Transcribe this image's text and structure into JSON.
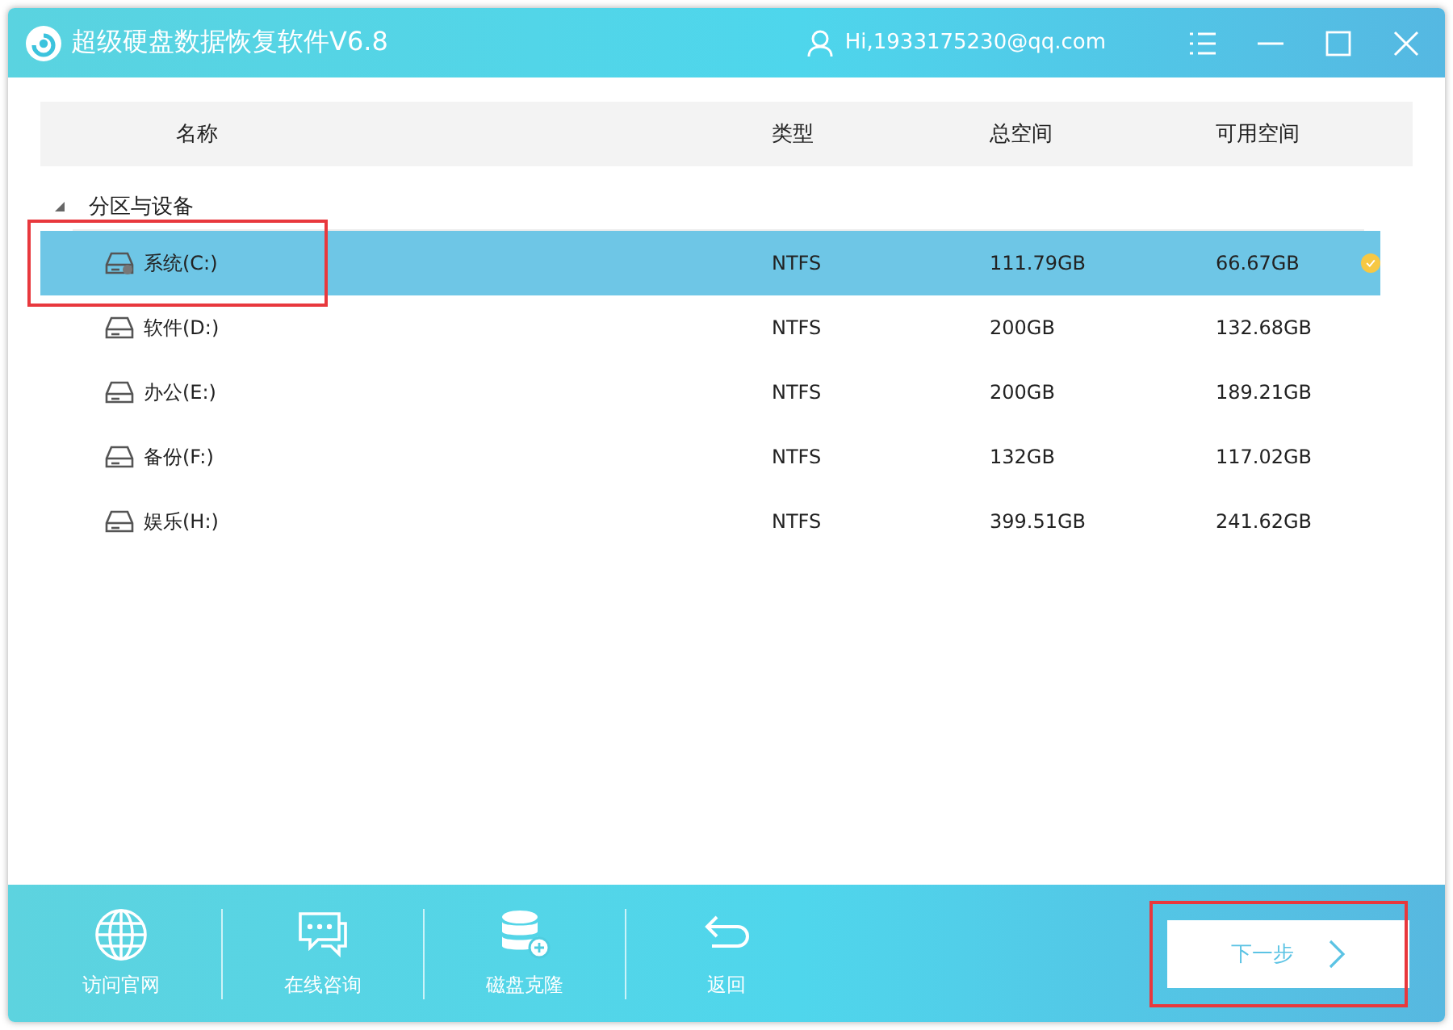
{
  "window": {
    "title": "超级硬盘数据恢复软件V6.8",
    "user": "Hi,1933175230@qq.com"
  },
  "table": {
    "columns": [
      "名称",
      "类型",
      "总空间",
      "可用空间"
    ],
    "group": {
      "label": "分区与设备",
      "expanded": true,
      "partitions": [
        {
          "name": "系统(C:)",
          "kind": "system",
          "type": "NTFS",
          "total": "111.79GB",
          "free": "66.67GB",
          "selected": true,
          "highlighted": true
        },
        {
          "name": "软件(D:)",
          "kind": "drive",
          "type": "NTFS",
          "total": "200GB",
          "free": "132.68GB",
          "selected": false,
          "highlighted": false
        },
        {
          "name": "办公(E:)",
          "kind": "drive",
          "type": "NTFS",
          "total": "200GB",
          "free": "189.21GB",
          "selected": false,
          "highlighted": false
        },
        {
          "name": "备份(F:)",
          "kind": "drive",
          "type": "NTFS",
          "total": "132GB",
          "free": "117.02GB",
          "selected": false,
          "highlighted": false
        },
        {
          "name": "娱乐(H:)",
          "kind": "drive",
          "type": "NTFS",
          "total": "399.51GB",
          "free": "241.62GB",
          "selected": false,
          "highlighted": false
        }
      ]
    }
  },
  "toolbar": [
    {
      "label": "访问官网",
      "kind": "globe"
    },
    {
      "label": "在线咨询",
      "kind": "chat"
    },
    {
      "label": "磁盘克隆",
      "kind": "database"
    },
    {
      "label": "返回",
      "kind": "back"
    }
  ],
  "next_button": {
    "label": "下一步",
    "highlighted": true
  }
}
